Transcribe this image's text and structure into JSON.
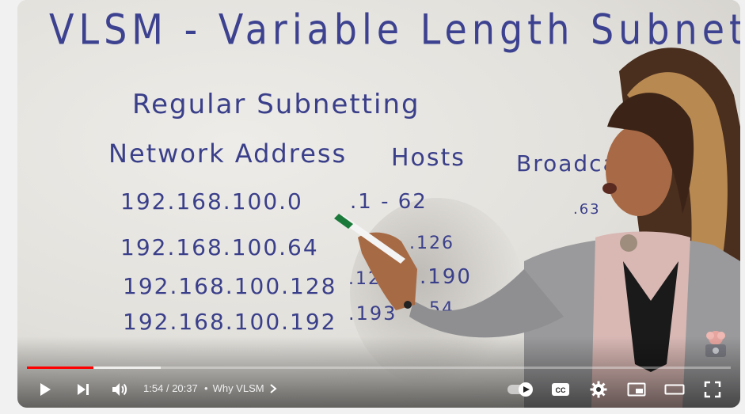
{
  "board": {
    "title": "VLSM - Variable Length Subnet Mask",
    "subtitle": "Regular Subnetting",
    "columns": [
      "Network Address",
      "Hosts",
      "Broadcas"
    ],
    "networks": [
      "192.168.100.0",
      "192.168.100.64",
      "192.168.100.128",
      "192.168.100.192"
    ],
    "hosts": [
      ".1 - 62",
      ".126",
      ".12",
      ".190",
      ".193",
      "54"
    ],
    "broadcast": [
      ".63"
    ]
  },
  "player": {
    "time_current": "1:54",
    "time_separator": "/",
    "time_total": "20:37",
    "chapter_bullet": "•",
    "chapter": "Why VLSM",
    "cc_label": "CC",
    "progress_played_fraction": 0.094,
    "progress_buffered_fraction": 0.19,
    "played_color": "#ff0000"
  }
}
